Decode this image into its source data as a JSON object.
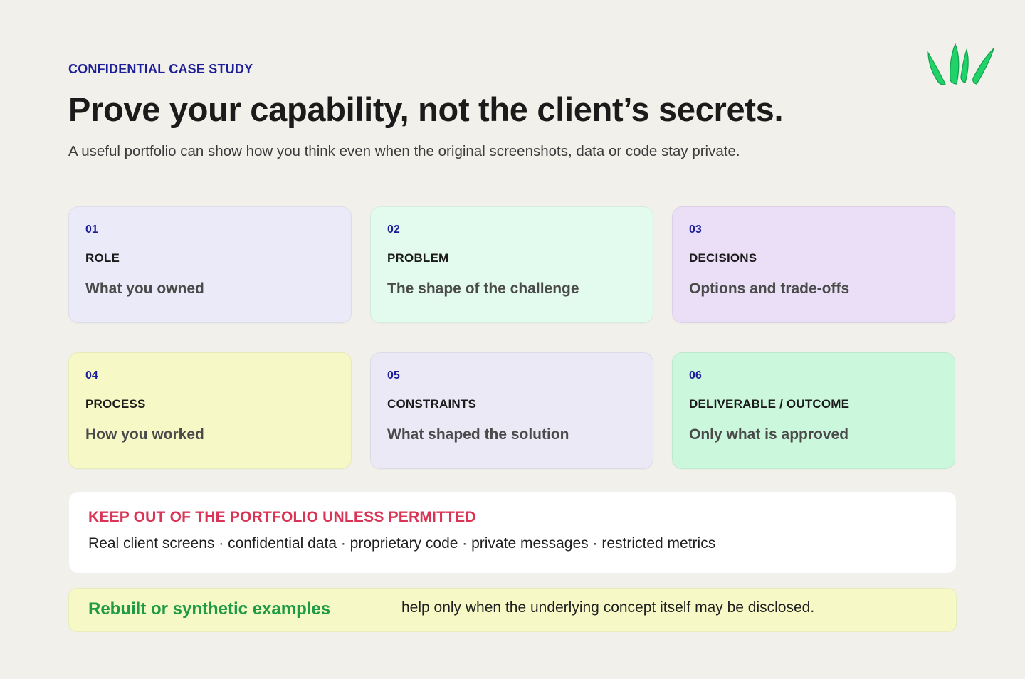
{
  "header": {
    "eyebrow": "CONFIDENTIAL CASE STUDY",
    "title": "Prove your capability, not the client’s secrets.",
    "subtitle": "A useful portfolio can show how you think even when the original screenshots, data or code stay private."
  },
  "logo": {
    "icon": "leaf-sprout-logo",
    "color": "#1fd369"
  },
  "cards": [
    {
      "num": "01",
      "label": "ROLE",
      "desc": "What you owned",
      "color": "#ebeaf8"
    },
    {
      "num": "02",
      "label": "PROBLEM",
      "desc": "The shape of the challenge",
      "color": "#e3fbee"
    },
    {
      "num": "03",
      "label": "DECISIONS",
      "desc": "Options and trade-offs",
      "color": "#eadff7"
    },
    {
      "num": "04",
      "label": "PROCESS",
      "desc": "How you worked",
      "color": "#f6f9c6"
    },
    {
      "num": "05",
      "label": "CONSTRAINTS",
      "desc": "What shaped the solution",
      "color": "#ebe9f6"
    },
    {
      "num": "06",
      "label": "DELIVERABLE / OUTCOME",
      "desc": "Only what is approved",
      "color": "#cbf8dc"
    }
  ],
  "keep_out": {
    "heading": "KEEP OUT OF THE PORTFOLIO UNLESS PERMITTED",
    "items": "Real client screens · confidential data · proprietary code · private messages · restricted metrics",
    "heading_color": "#d93455"
  },
  "rebuilt": {
    "emphasis": "Rebuilt or synthetic examples",
    "rest": "help only when the underlying concept itself may be disclosed.",
    "emphasis_color": "#1f9a45"
  },
  "accent": "#1d1e9a"
}
